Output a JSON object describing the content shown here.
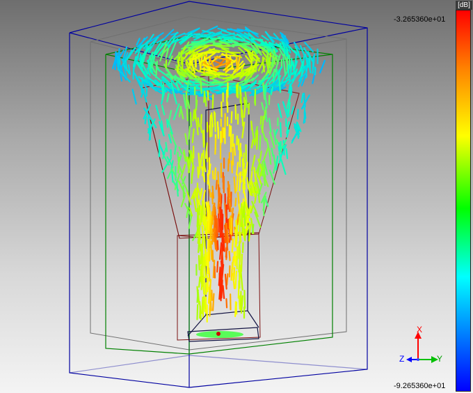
{
  "colorbar": {
    "unit": "[dB]",
    "max_label": "-3.265360e+01",
    "min_label": "-9.265360e+01",
    "stops": [
      "#ff0000",
      "#ff8000",
      "#ffff00",
      "#00ff00",
      "#00ffff",
      "#0080ff",
      "#0000ff"
    ]
  },
  "axes": {
    "x_label": "X",
    "y_label": "Y",
    "z_label": "Z",
    "x_color": "#ff0000",
    "y_color": "#00c000",
    "z_color": "#0000ff"
  },
  "icons": {
    "colorbar": "colorbar-legend",
    "axes": "axes-triad-icon"
  }
}
